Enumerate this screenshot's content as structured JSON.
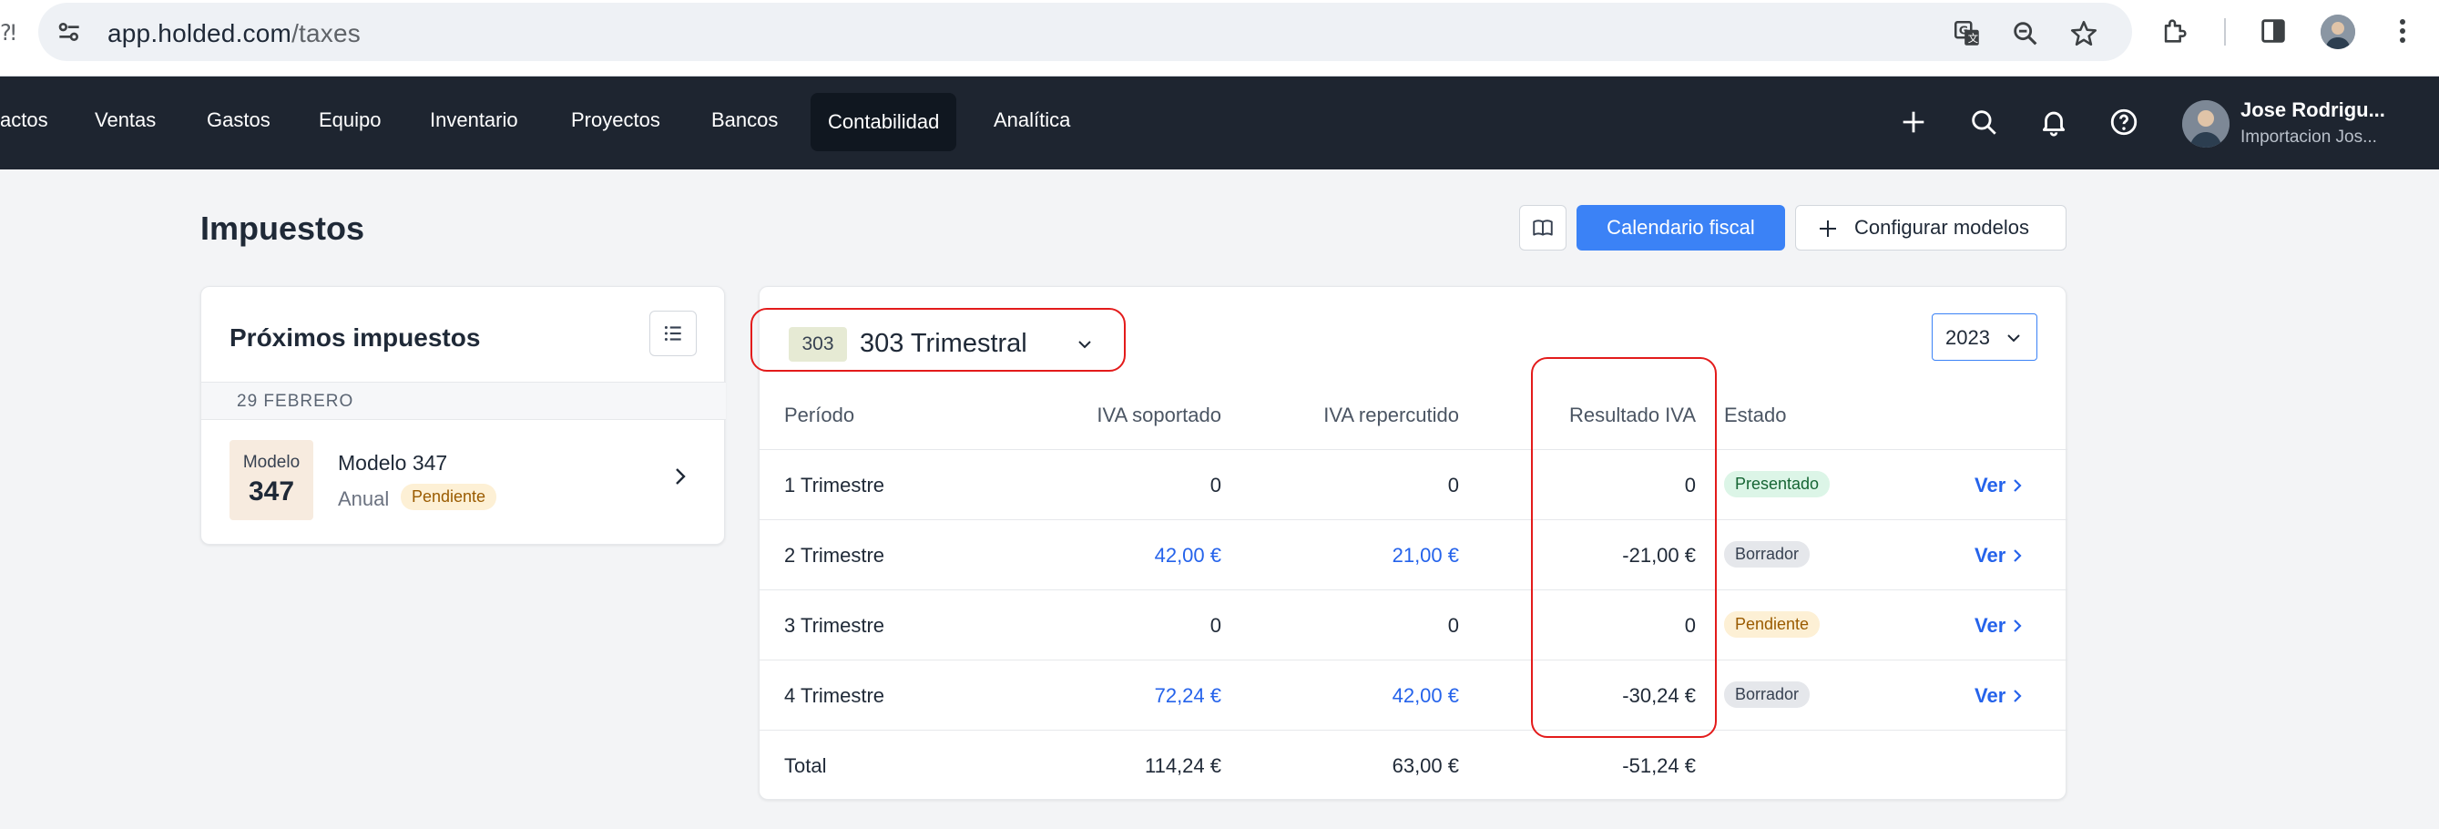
{
  "browser": {
    "url_domain": "app.holded.com",
    "url_path": "/taxes",
    "icons": [
      "site-settings-icon",
      "translate-icon",
      "zoom-icon",
      "bookmark-star-icon",
      "extensions-icon",
      "side-panel-icon",
      "profile-avatar",
      "more-menu-icon"
    ]
  },
  "nav": {
    "items": [
      "actos",
      "Ventas",
      "Gastos",
      "Equipo",
      "Inventario",
      "Proyectos",
      "Bancos",
      "Contabilidad",
      "Analítica"
    ],
    "active": "Contabilidad",
    "user_name": "Jose Rodrigu...",
    "user_company": "Importacion Jos..."
  },
  "page": {
    "title": "Impuestos",
    "buttons": {
      "calendar": "Calendario fiscal",
      "configure": "Configurar modelos"
    }
  },
  "upcoming": {
    "title": "Próximos impuestos",
    "date_header": "29 FEBRERO",
    "item": {
      "box_label": "Modelo",
      "box_number": "347",
      "name": "Modelo 347",
      "frequency": "Anual",
      "status": "Pendiente"
    }
  },
  "taxes_table": {
    "model_chip": "303",
    "model_label": "303 Trimestral",
    "year": "2023",
    "columns": [
      "Período",
      "IVA soportado",
      "IVA repercutido",
      "Resultado IVA",
      "Estado"
    ],
    "rows": [
      {
        "period": "1 Trimestre",
        "soportado": "0",
        "repercutido": "0",
        "resultado": "0",
        "estado": "Presentado",
        "estado_type": "pres",
        "link": "Ver"
      },
      {
        "period": "2 Trimestre",
        "soportado": "42,00 €",
        "repercutido": "21,00 €",
        "resultado": "-21,00 €",
        "estado": "Borrador",
        "estado_type": "borr",
        "link": "Ver"
      },
      {
        "period": "3 Trimestre",
        "soportado": "0",
        "repercutido": "0",
        "resultado": "0",
        "estado": "Pendiente",
        "estado_type": "pend",
        "link": "Ver"
      },
      {
        "period": "4 Trimestre",
        "soportado": "72,24 €",
        "repercutido": "42,00 €",
        "resultado": "-30,24 €",
        "estado": "Borrador",
        "estado_type": "borr",
        "link": "Ver"
      }
    ],
    "total": {
      "label": "Total",
      "soportado": "114,24 €",
      "repercutido": "63,00 €",
      "resultado": "-51,24 €"
    }
  },
  "colors": {
    "nav_bg": "#1e2530",
    "primary": "#3b82f6",
    "link": "#2563eb",
    "annotation": "#e31b1b"
  }
}
